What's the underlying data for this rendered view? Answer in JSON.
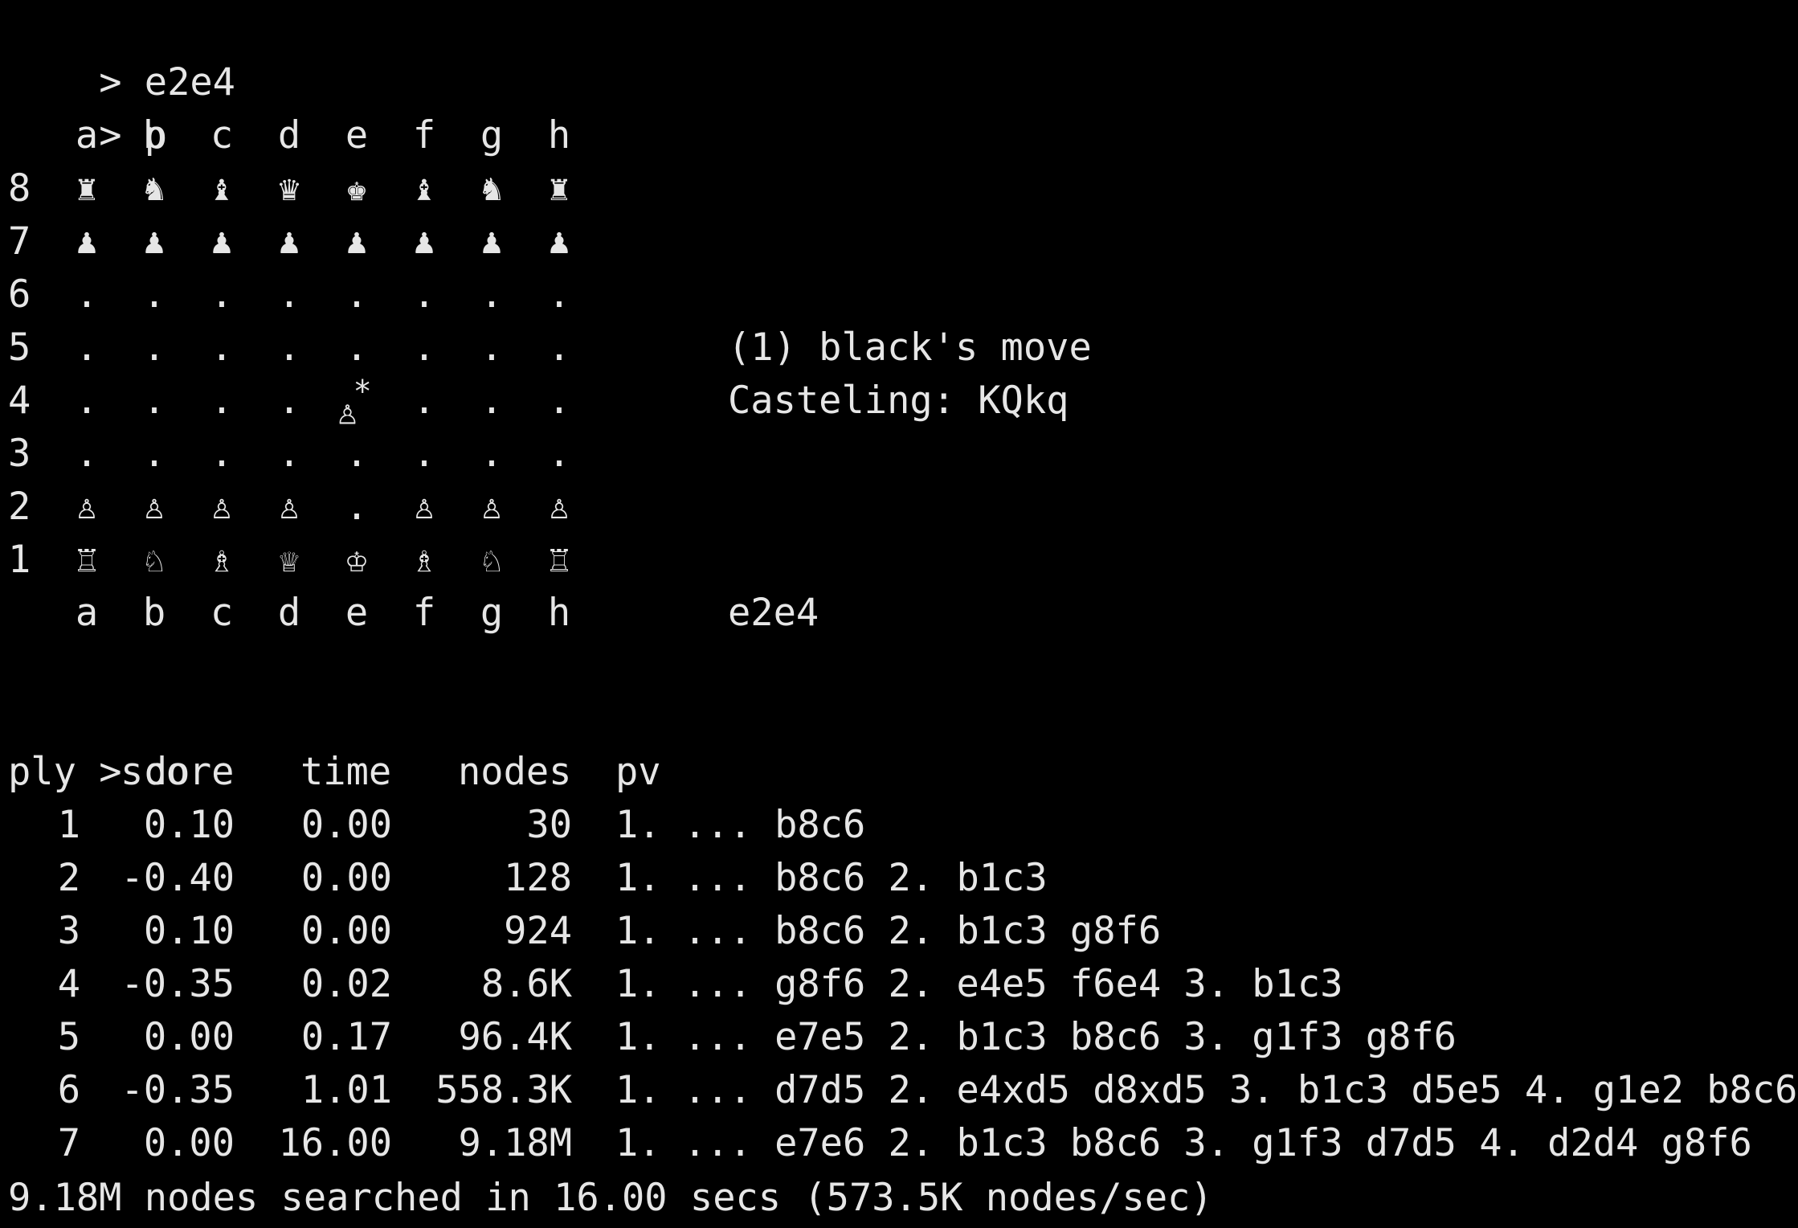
{
  "terminal": {
    "prompt": ">",
    "commands": [
      "e2e4",
      "p",
      "do"
    ]
  },
  "board": {
    "files": [
      "a",
      "b",
      "c",
      "d",
      "e",
      "f",
      "g",
      "h"
    ],
    "ranks": [
      {
        "rank": "8",
        "squares": [
          "♜",
          "♞",
          "♝",
          "♛",
          "♚",
          "♝",
          "♞",
          "♜"
        ]
      },
      {
        "rank": "7",
        "squares": [
          "♟",
          "♟",
          "♟",
          "♟",
          "♟",
          "♟",
          "♟",
          "♟"
        ]
      },
      {
        "rank": "6",
        "squares": [
          ".",
          ".",
          ".",
          ".",
          ".",
          ".",
          ".",
          "."
        ]
      },
      {
        "rank": "5",
        "squares": [
          ".",
          ".",
          ".",
          ".",
          ".",
          ".",
          ".",
          "."
        ]
      },
      {
        "rank": "4",
        "squares": [
          ".",
          ".",
          ".",
          ".",
          "♙",
          ".",
          ".",
          "."
        ]
      },
      {
        "rank": "3",
        "squares": [
          ".",
          ".",
          ".",
          ".",
          ".",
          ".",
          ".",
          "."
        ]
      },
      {
        "rank": "2",
        "squares": [
          "♙",
          "♙",
          "♙",
          "♙",
          ".",
          "♙",
          "♙",
          "♙"
        ]
      },
      {
        "rank": "1",
        "squares": [
          "♖",
          "♘",
          "♗",
          "♕",
          "♔",
          "♗",
          "♘",
          "♖"
        ]
      }
    ],
    "last_move_marker": "*",
    "status_move": "(1) black's move",
    "castling": "Casteling: KQkq",
    "last_move": "e2e4"
  },
  "search": {
    "headers": {
      "ply": "ply",
      "score": "score",
      "time": "time",
      "nodes": "nodes",
      "pv": "pv"
    },
    "rows": [
      {
        "ply": "1",
        "score": "0.10",
        "time": "0.00",
        "nodes": "30",
        "pv": "1. ... b8c6"
      },
      {
        "ply": "2",
        "score": "-0.40",
        "time": "0.00",
        "nodes": "128",
        "pv": "1. ... b8c6 2. b1c3"
      },
      {
        "ply": "3",
        "score": "0.10",
        "time": "0.00",
        "nodes": "924",
        "pv": "1. ... b8c6 2. b1c3 g8f6"
      },
      {
        "ply": "4",
        "score": "-0.35",
        "time": "0.02",
        "nodes": "8.6K",
        "pv": "1. ... g8f6 2. e4e5 f6e4 3. b1c3"
      },
      {
        "ply": "5",
        "score": "0.00",
        "time": "0.17",
        "nodes": "96.4K",
        "pv": "1. ... e7e5 2. b1c3 b8c6 3. g1f3 g8f6"
      },
      {
        "ply": "6",
        "score": "-0.35",
        "time": "1.01",
        "nodes": "558.3K",
        "pv": "1. ... d7d5 2. e4xd5 d8xd5 3. b1c3 d5e5 4. g1e2 b8c6"
      },
      {
        "ply": "7",
        "score": "0.00",
        "time": "16.00",
        "nodes": "9.18M",
        "pv": "1. ... e7e6 2. b1c3 b8c6 3. g1f3 d7d5 4. d2d4 g8f6"
      }
    ],
    "summary": "9.18M nodes searched in 16.00 secs (573.5K nodes/sec)"
  }
}
